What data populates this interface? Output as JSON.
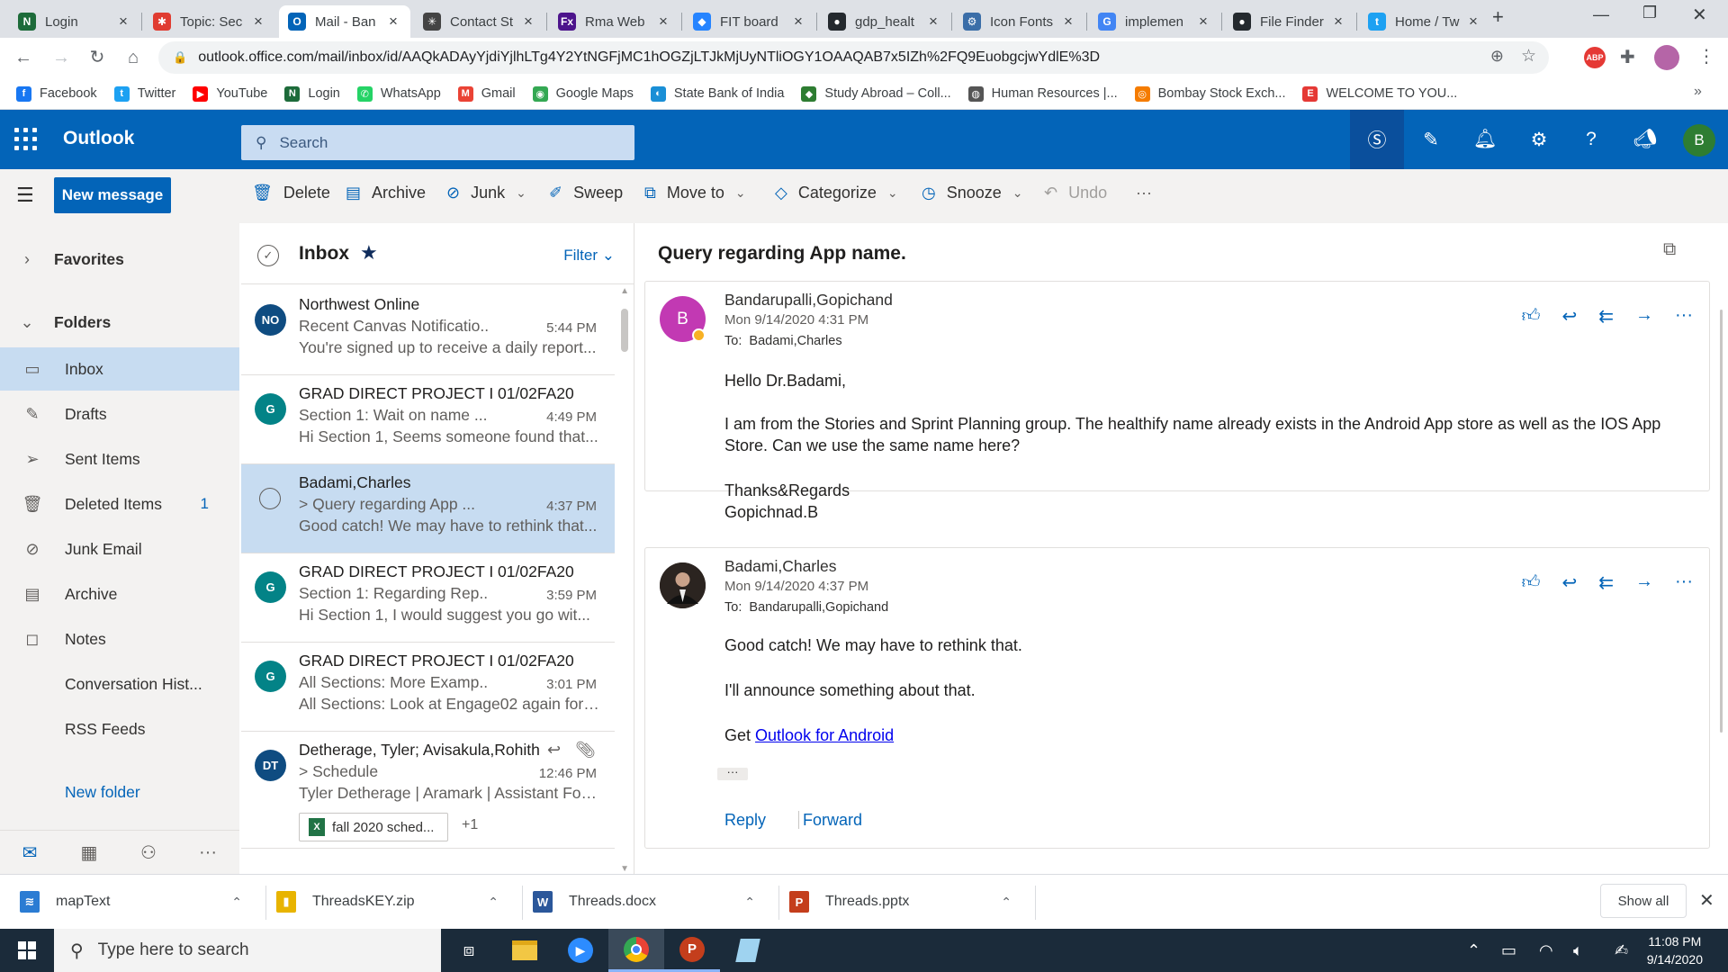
{
  "browser": {
    "tabs": [
      {
        "label": "Login",
        "icon": "N",
        "color": "#1d6b3a"
      },
      {
        "label": "Topic: Sec",
        "icon": "✱",
        "color": "#e03c31"
      },
      {
        "label": "Mail - Ban",
        "icon": "O",
        "color": "#0364b8"
      },
      {
        "label": "Contact St",
        "icon": "✳",
        "color": "#444444"
      },
      {
        "label": "Rma Web",
        "icon": "Fx",
        "color": "#4d148c"
      },
      {
        "label": "FIT board",
        "icon": "◆",
        "color": "#2684ff"
      },
      {
        "label": "gdp_healt",
        "icon": "●",
        "color": "#24292e"
      },
      {
        "label": "Icon Fonts",
        "icon": "⚙",
        "color": "#3b6ea8"
      },
      {
        "label": "implemen",
        "icon": "G",
        "color": "#4285f4"
      },
      {
        "label": "File Finder",
        "icon": "●",
        "color": "#24292e"
      },
      {
        "label": "Home / Tw",
        "icon": "t",
        "color": "#1da1f2"
      }
    ],
    "url": "outlook.office.com/mail/inbox/id/AAQkADAyYjdiYjlhLTg4Y2YtNGFjMC1hOGZjLTJkMjUyNTliOGY1OAAQAB7x5IZh%2FQ9EuobgcjwYdlE%3D",
    "bookmarks": [
      {
        "label": "Facebook",
        "icon": "f",
        "color": "#1877f2"
      },
      {
        "label": "Twitter",
        "icon": "t",
        "color": "#1da1f2"
      },
      {
        "label": "YouTube",
        "icon": "▶",
        "color": "#ff0000"
      },
      {
        "label": "Login",
        "icon": "N",
        "color": "#1d6b3a"
      },
      {
        "label": "WhatsApp",
        "icon": "✆",
        "color": "#25d366"
      },
      {
        "label": "Gmail",
        "icon": "M",
        "color": "#ea4335"
      },
      {
        "label": "Google Maps",
        "icon": "◉",
        "color": "#34a853"
      },
      {
        "label": "State Bank of India",
        "icon": "◐",
        "color": "#1a8fd6"
      },
      {
        "label": "Study Abroad – Coll...",
        "icon": "◆",
        "color": "#2e7d32"
      },
      {
        "label": "Human Resources |...",
        "icon": "◍",
        "color": "#555555"
      },
      {
        "label": "Bombay Stock Exch...",
        "icon": "◎",
        "color": "#f57c00"
      },
      {
        "label": "WELCOME TO YOU...",
        "icon": "E",
        "color": "#e53935"
      }
    ]
  },
  "outlook": {
    "brand": "Outlook",
    "search_placeholder": "Search",
    "user_initial": "B"
  },
  "toolbar": {
    "new_message": "New message",
    "delete": "Delete",
    "archive": "Archive",
    "junk": "Junk",
    "sweep": "Sweep",
    "move_to": "Move to",
    "categorize": "Categorize",
    "snooze": "Snooze",
    "undo": "Undo",
    "more": "···"
  },
  "folders": {
    "favorites": "Favorites",
    "folders": "Folders",
    "items": [
      {
        "label": "Inbox",
        "icon": "▭",
        "count": ""
      },
      {
        "label": "Drafts",
        "icon": "✎",
        "count": ""
      },
      {
        "label": "Sent Items",
        "icon": "➢",
        "count": ""
      },
      {
        "label": "Deleted Items",
        "icon": "🗑",
        "count": "1"
      },
      {
        "label": "Junk Email",
        "icon": "⊘",
        "count": ""
      },
      {
        "label": "Archive",
        "icon": "▤",
        "count": ""
      },
      {
        "label": "Notes",
        "icon": "◻",
        "count": ""
      },
      {
        "label": "Conversation Hist...",
        "icon": "",
        "count": ""
      },
      {
        "label": "RSS Feeds",
        "icon": "",
        "count": ""
      }
    ],
    "new_folder": "New folder"
  },
  "list": {
    "title": "Inbox",
    "filter": "Filter",
    "messages": [
      {
        "initials": "NO",
        "color": "#0f4c81",
        "sender": "Northwest Online",
        "subject": "Recent Canvas Notificatio...",
        "time": "5:44 PM",
        "preview": "You're signed up to receive a daily report..."
      },
      {
        "initials": "G",
        "color": "#038387",
        "sender": "GRAD DIRECT PROJECT I 01/02FA20",
        "subject": "Section 1: Wait on name ...",
        "time": "4:49 PM",
        "preview": "Hi Section 1, Seems someone found that..."
      },
      {
        "initials": "",
        "color": "",
        "sender": "Badami,Charles",
        "subject": "> Query regarding App ...",
        "time": "4:37 PM",
        "preview": "Good catch! We may have to rethink that..."
      },
      {
        "initials": "G",
        "color": "#038387",
        "sender": "GRAD DIRECT PROJECT I 01/02FA20",
        "subject": "Section 1: Regarding Rep...",
        "time": "3:59 PM",
        "preview": "Hi Section 1, I would suggest you go wit..."
      },
      {
        "initials": "G",
        "color": "#038387",
        "sender": "GRAD DIRECT PROJECT I 01/02FA20",
        "subject": "All Sections: More Examp...",
        "time": "3:01 PM",
        "preview": "All Sections: Look at Engage02 again for ..."
      },
      {
        "initials": "DT",
        "color": "#0f4c81",
        "sender": "Detherage, Tyler; Avisakula,Rohith",
        "subject": "> Schedule",
        "time": "12:46 PM",
        "preview": "Tyler Detherage | Aramark | Assistant Foo..."
      }
    ],
    "attachment": "fall 2020 sched...",
    "attachment_more": "+1"
  },
  "reading": {
    "subject": "Query regarding App name.",
    "messages": [
      {
        "initial": "B",
        "sender": "Bandarupalli,Gopichand",
        "date": "Mon 9/14/2020 4:31 PM",
        "to_label": "To:",
        "to": "Badami,Charles",
        "greeting": "Hello Dr.Badami,",
        "body": "I am from the Stories and Sprint Planning group. The healthify name already exists in the Android App store as well as the IOS App Store. Can we use the same name here?",
        "sign1": "Thanks&Regards",
        "sign2": "Gopichnad.B"
      },
      {
        "sender": "Badami,Charles",
        "date": "Mon 9/14/2020 4:37 PM",
        "to_label": "To:",
        "to": "Bandarupalli,Gopichand",
        "line1": "Good catch! We may have to rethink that.",
        "line2": "I'll announce something about that.",
        "get": "Get",
        "link": "Outlook for Android",
        "ellipsis": "···",
        "reply": "Reply",
        "forward": "Forward"
      }
    ]
  },
  "downloads": {
    "items": [
      {
        "label": "mapText",
        "icon": "≋",
        "color": "#2b7cd3"
      },
      {
        "label": "ThreadsKEY.zip",
        "icon": "▮",
        "color": "#e8b400"
      },
      {
        "label": "Threads.docx",
        "icon": "W",
        "color": "#2b579a"
      },
      {
        "label": "Threads.pptx",
        "icon": "P",
        "color": "#c43e1c"
      }
    ],
    "show_all": "Show all"
  },
  "taskbar": {
    "search_placeholder": "Type here to search",
    "time": "11:08 PM",
    "date": "9/14/2020"
  }
}
